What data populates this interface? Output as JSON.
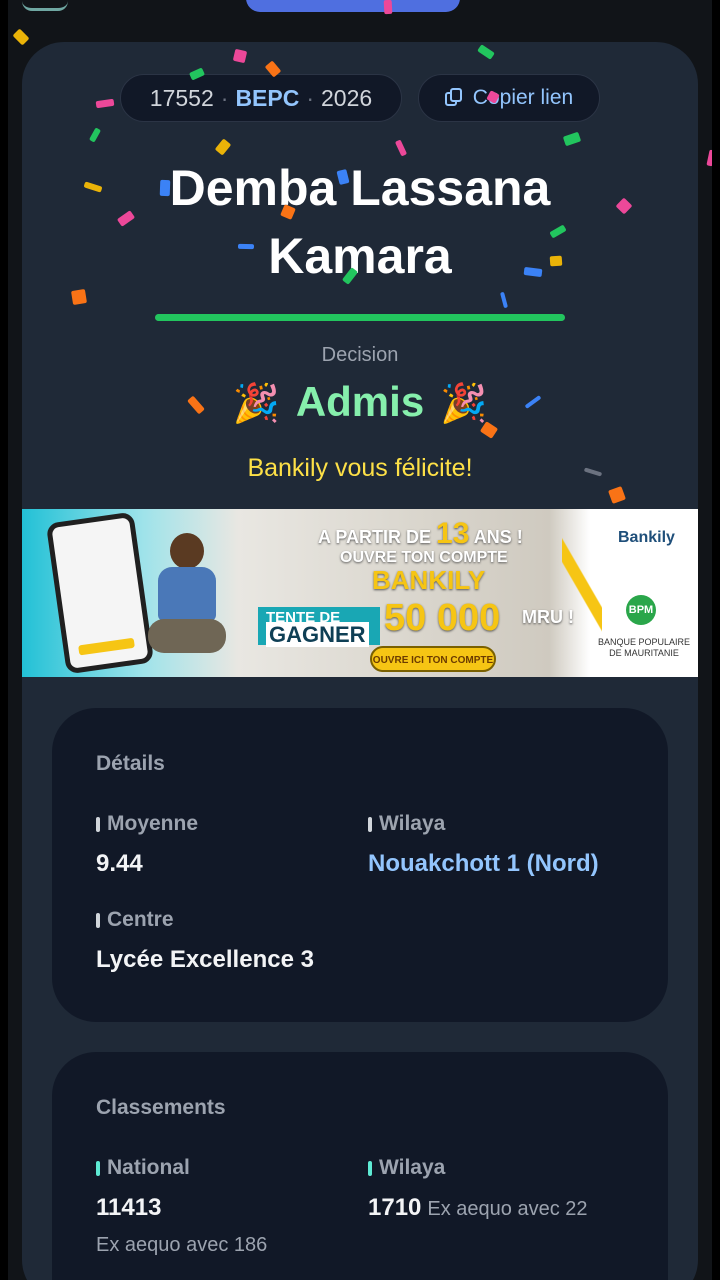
{
  "header": {
    "candidate_number": "17552",
    "exam": "BEPC",
    "year": "2026",
    "copy_link_label": "Copier lien"
  },
  "candidate": {
    "name_line1": "Demba Lassana",
    "name_line2": "Kamara"
  },
  "decision": {
    "label": "Decision",
    "value": "Admis",
    "emoji": "🎉",
    "congrats": "Bankily vous félicite!",
    "progress": 1.0
  },
  "banner": {
    "line1_prefix": "A PARTIR DE",
    "line1_age": "13",
    "line1_suffix": "ANS !",
    "line2": "OUVRE TON COMPTE",
    "line3": "BANKILY",
    "tente_label": "TENTE DE",
    "gagner_label": "GAGNER",
    "amount": "50 000",
    "currency": "MRU !",
    "cta": "OUVRE ICI TON COMPTE",
    "brand": "Bankily",
    "bank_logo": "BPM",
    "bank_name": "BANQUE POPULAIRE DE MAURITANIE"
  },
  "details": {
    "title": "Détails",
    "moyenne_label": "Moyenne",
    "moyenne_value": "9.44",
    "wilaya_label": "Wilaya",
    "wilaya_value": "Nouakchott 1 (Nord)",
    "centre_label": "Centre",
    "centre_value": "Lycée Excellence 3"
  },
  "rankings": {
    "title": "Classements",
    "national_label": "National",
    "national_value": "11413",
    "national_note": "Ex aequo avec 186",
    "wilaya_label": "Wilaya",
    "wilaya_value": "1710",
    "wilaya_note": "Ex aequo avec 22"
  },
  "colors": {
    "accent_blue": "#93c5fd",
    "admis_green": "#86efac",
    "progress_green": "#22c55e",
    "congrats_yellow": "#fde047"
  }
}
